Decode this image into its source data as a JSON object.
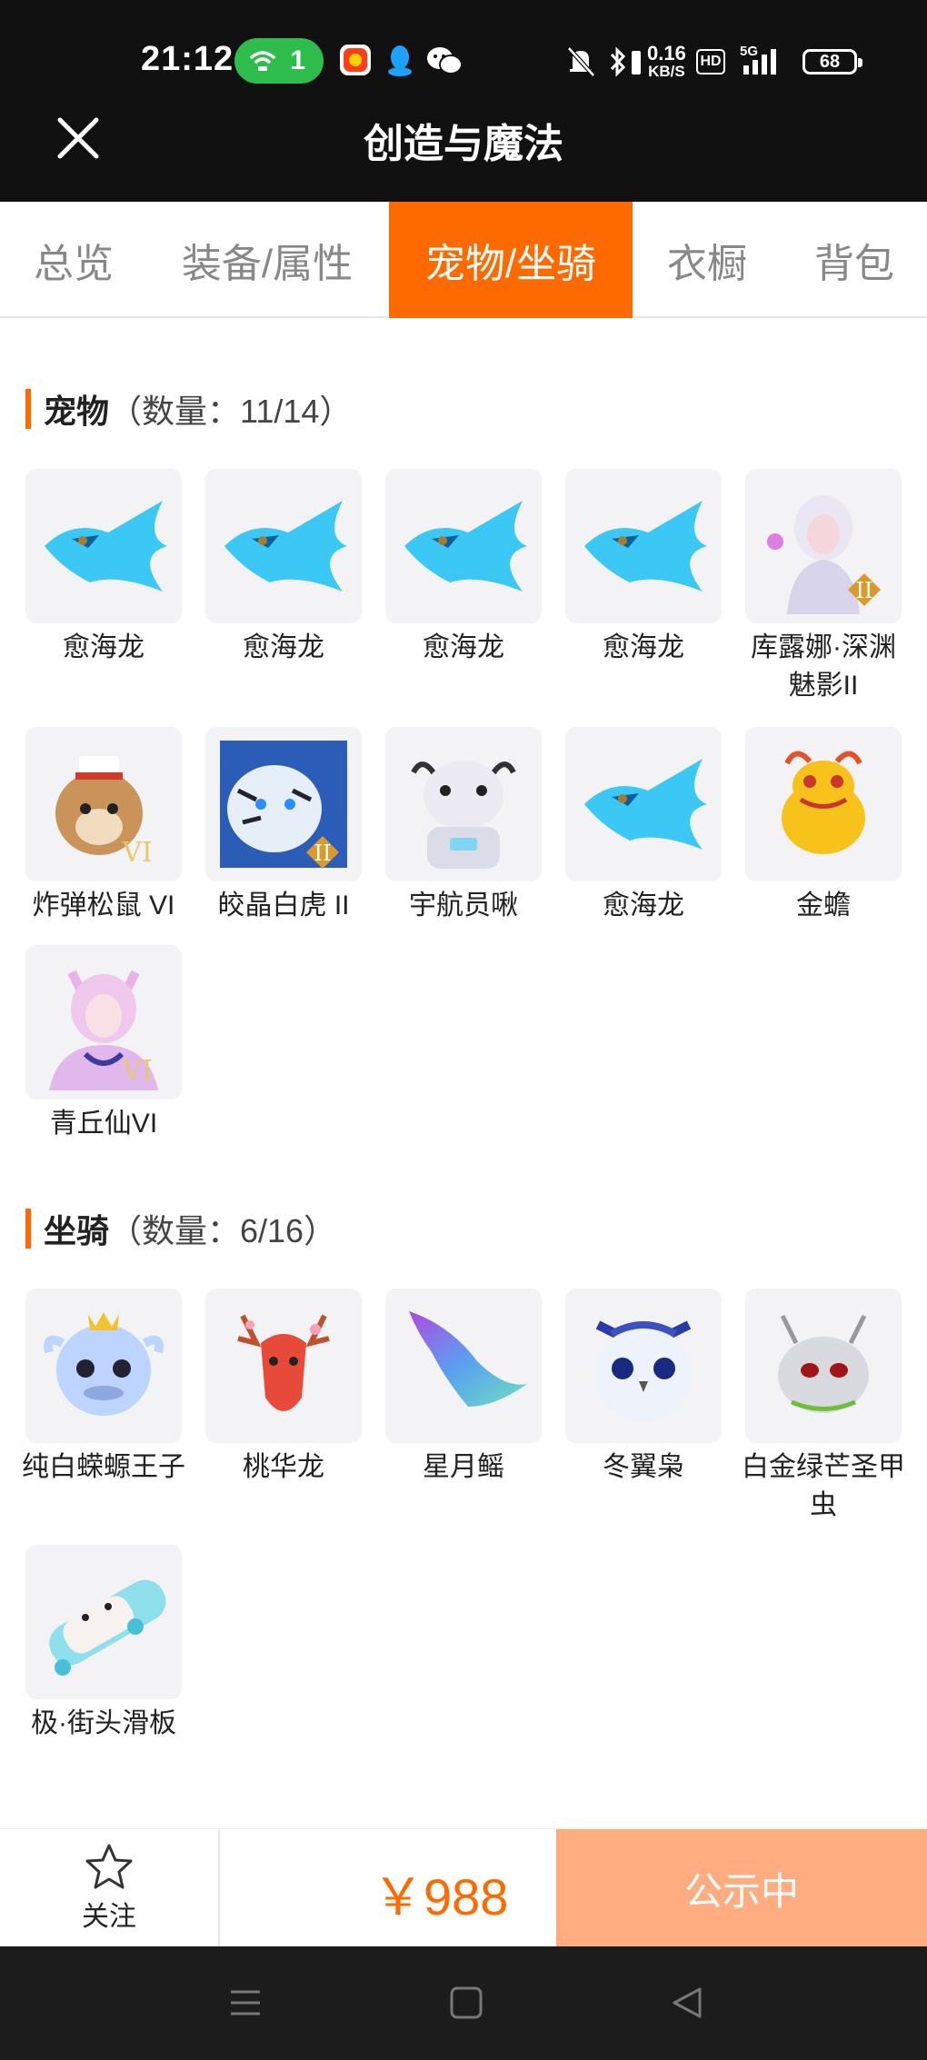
{
  "status_bar": {
    "time": "21:12",
    "wifi_count": "1",
    "net_speed_value": "0.16",
    "net_speed_unit": "KB/S",
    "hd": "HD",
    "signal": "5G",
    "battery": "68"
  },
  "header": {
    "title": "创造与魔法"
  },
  "tabs": [
    {
      "label": "总览"
    },
    {
      "label": "装备/属性"
    },
    {
      "label": "宠物/坐骑"
    },
    {
      "label": "衣橱"
    },
    {
      "label": "背包"
    }
  ],
  "active_tab": "宠物/坐骑",
  "pets": {
    "title": "宠物",
    "count_text": "（数量：11/14）",
    "items": [
      {
        "name": "愈海龙",
        "icon": "blue-dragon"
      },
      {
        "name": "愈海龙",
        "icon": "blue-dragon"
      },
      {
        "name": "愈海龙",
        "icon": "blue-dragon"
      },
      {
        "name": "愈海龙",
        "icon": "blue-dragon"
      },
      {
        "name": "库露娜·深渊魅影II",
        "icon": "white-girl-badge-ii"
      },
      {
        "name": "炸弹松鼠 VI",
        "icon": "squirrel-badge-vi"
      },
      {
        "name": "皎晶白虎 II",
        "icon": "white-tiger-badge-ii"
      },
      {
        "name": "宇航员啾",
        "icon": "astronaut-cow"
      },
      {
        "name": "愈海龙",
        "icon": "blue-dragon"
      },
      {
        "name": "金蟾",
        "icon": "golden-toad"
      },
      {
        "name": "青丘仙VI",
        "icon": "fox-fairy-badge-vi"
      }
    ]
  },
  "mounts": {
    "title": "坐骑",
    "count_text": "（数量：6/16）",
    "items": [
      {
        "name": "纯白蝾螈王子",
        "icon": "white-axolotl-prince"
      },
      {
        "name": "桃华龙",
        "icon": "peach-dragon"
      },
      {
        "name": "星月鳐",
        "icon": "star-moon-ray"
      },
      {
        "name": "冬翼枭",
        "icon": "winter-owl"
      },
      {
        "name": "白金绿芒圣甲虫",
        "icon": "platinum-beetle"
      },
      {
        "name": "极·街头滑板",
        "icon": "street-skateboard"
      }
    ]
  },
  "footer": {
    "follow_label": "关注",
    "price": "￥988",
    "action_label": "公示中"
  },
  "colors": {
    "accent": "#ff6a00",
    "action_button": "#ffad80",
    "header_bg": "#111111"
  }
}
